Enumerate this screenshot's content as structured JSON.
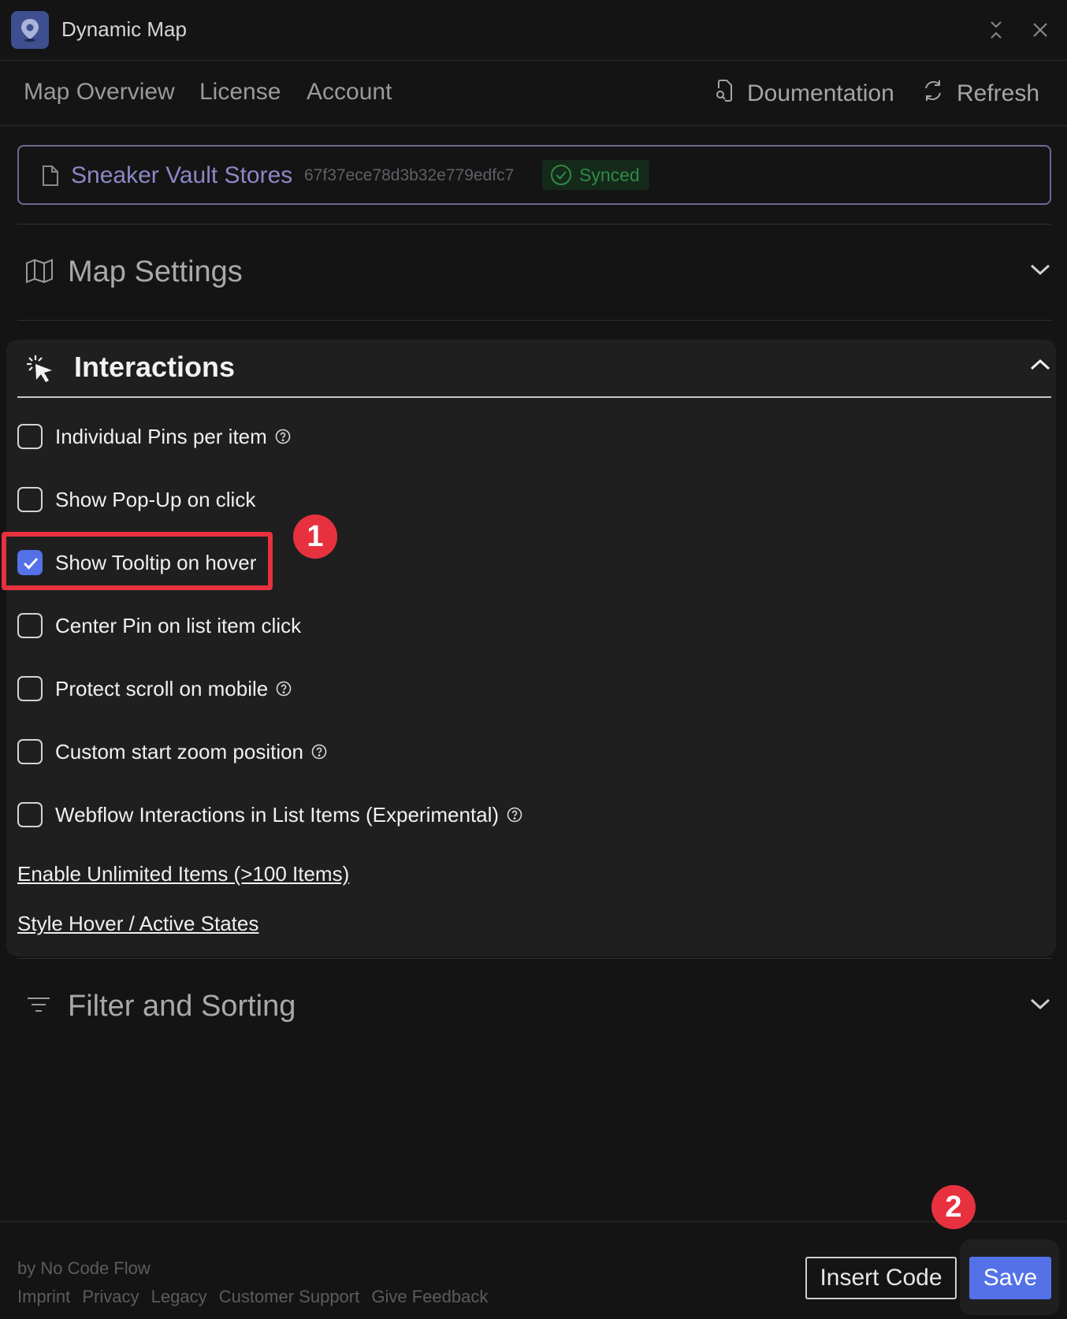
{
  "window": {
    "title": "Dynamic Map"
  },
  "nav": {
    "items": [
      {
        "label": "Map Overview"
      },
      {
        "label": "License"
      },
      {
        "label": "Account"
      }
    ],
    "documentation_label": "Doumentation",
    "refresh_label": "Refresh"
  },
  "collection": {
    "name": "Sneaker Vault Stores",
    "id": "67f37ece78d3b32e779edfc7",
    "status": "Synced"
  },
  "sections": {
    "map_settings": {
      "title": "Map Settings",
      "expanded": false
    },
    "interactions": {
      "title": "Interactions",
      "expanded": true
    },
    "filter_sorting": {
      "title": "Filter and Sorting",
      "expanded": false
    }
  },
  "options": [
    {
      "label": "Individual Pins per item",
      "checked": false,
      "help": true
    },
    {
      "label": "Show Pop-Up on click",
      "checked": false,
      "help": false
    },
    {
      "label": "Show Tooltip on hover",
      "checked": true,
      "help": false
    },
    {
      "label": "Center Pin on list item click",
      "checked": false,
      "help": false
    },
    {
      "label": "Protect scroll on mobile",
      "checked": false,
      "help": true
    },
    {
      "label": "Custom start zoom position",
      "checked": false,
      "help": true
    },
    {
      "label": "Webflow Interactions in List Items (Experimental)",
      "checked": false,
      "help": true
    }
  ],
  "links": {
    "unlimited": "Enable Unlimited Items (>100 Items)",
    "style_states": "Style Hover / Active States"
  },
  "annotations": {
    "step1": "1",
    "step2": "2"
  },
  "footer": {
    "by": "by No Code Flow",
    "links": [
      "Imprint",
      "Privacy",
      "Legacy",
      "Customer Support",
      "Give Feedback"
    ],
    "insert_code": "Insert Code",
    "save": "Save"
  },
  "colors": {
    "accent": "#5471e8",
    "annotation": "#e8313f",
    "synced": "#2f8a45",
    "collection_name": "#8c87c6"
  }
}
